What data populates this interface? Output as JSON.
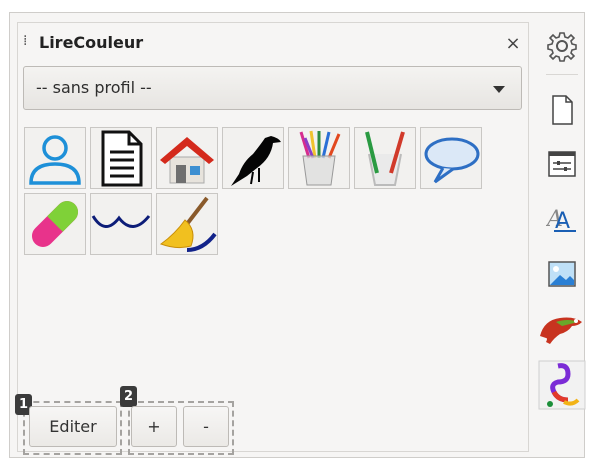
{
  "panel": {
    "title": "LireCouleur",
    "close_glyph": "×",
    "profile_select": {
      "selected": "-- sans profil --"
    },
    "tool_icons": [
      "user-icon",
      "document-icon",
      "house-icon",
      "blackbird-icon",
      "colored-pencils-icon",
      "pencils-in-glass-icon",
      "speech-bubble-icon",
      "pill-icon",
      "wave-line-icon",
      "broom-icon"
    ],
    "buttons": {
      "edit_label": "Editer",
      "add_label": "+",
      "remove_label": "-"
    },
    "badges": {
      "edit": "1",
      "add_remove": "2"
    }
  },
  "sidebar": {
    "icons": [
      "gear-icon",
      "page-icon",
      "properties-icon",
      "styles-icon",
      "gallery-icon",
      "chameleon-icon",
      "lirecouleur-logo-icon"
    ]
  },
  "colors": {
    "panel_bg": "#f6f5f4",
    "accent_blue": "#1e90d8",
    "badge_bg": "#3b3b3b"
  }
}
